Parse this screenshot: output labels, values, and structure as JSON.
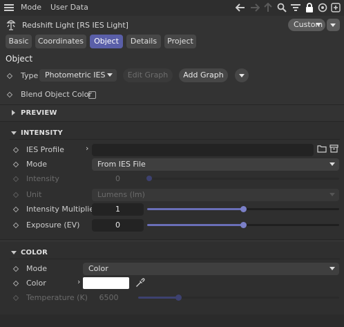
{
  "menubar": {
    "mode_label": "Mode",
    "user_data_label": "User Data",
    "icons": [
      "hamburger-icon",
      "back-arrow-icon",
      "forward-arrow-icon",
      "up-arrow-icon",
      "search-icon",
      "filter-icon",
      "lock-icon",
      "target-icon",
      "add-icon"
    ]
  },
  "titlebar": {
    "object_title": "Redshift Light [RS IES Light]",
    "preset_dropdown": "Custom"
  },
  "tabs": [
    {
      "label": "Basic",
      "active": false
    },
    {
      "label": "Coordinates",
      "active": false
    },
    {
      "label": "Object",
      "active": true
    },
    {
      "label": "Details",
      "active": false
    },
    {
      "label": "Project",
      "active": false
    }
  ],
  "object_section": {
    "heading": "Object",
    "type_label": "Type",
    "type_value": "Photometric IES",
    "edit_graph_label": "Edit Graph",
    "add_graph_label": "Add Graph",
    "blend_label": "Blend Object Color",
    "blend_checked": false
  },
  "preview_group": {
    "label": "PREVIEW",
    "expanded": false
  },
  "intensity_group": {
    "label": "INTENSITY",
    "expanded": true,
    "ies_profile_label": "IES Profile",
    "ies_profile_value": "",
    "mode_label": "Mode",
    "mode_value": "From IES File",
    "intensity_label": "Intensity",
    "intensity_value": "0",
    "unit_label": "Unit",
    "unit_value": "Lumens (lm)",
    "multiplier_label": "Intensity Multiplier",
    "multiplier_value": "1",
    "multiplier_slider": 0.5,
    "exposure_label": "Exposure (EV)",
    "exposure_value": "0",
    "exposure_slider": 0.5
  },
  "color_group": {
    "label": "COLOR",
    "expanded": true,
    "mode_label": "Mode",
    "mode_value": "Color",
    "color_label": "Color",
    "color_value": "#ffffff",
    "temperature_label": "Temperature (K)",
    "temperature_value": "6500",
    "temperature_slider": 0.2
  },
  "colors": {
    "accent": "#5a5fa8",
    "slider_fill": "#6a6fb8",
    "background": "#333333"
  }
}
